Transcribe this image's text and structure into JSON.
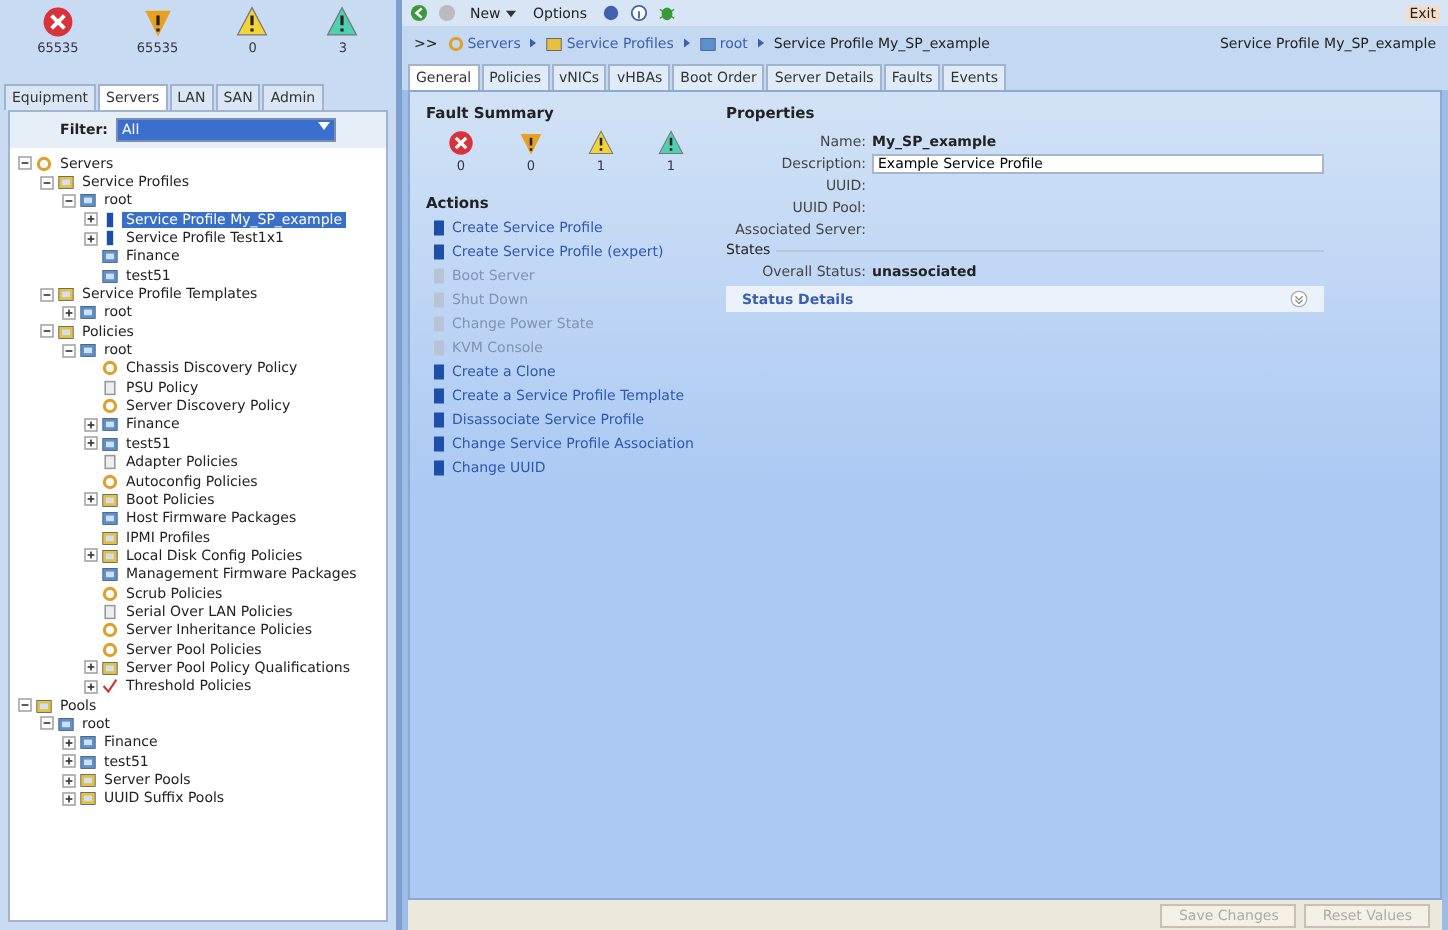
{
  "left_panel": {
    "faults": [
      {
        "kind": "critical",
        "count": "65535"
      },
      {
        "kind": "major",
        "count": "65535"
      },
      {
        "kind": "minor",
        "count": "0"
      },
      {
        "kind": "warning",
        "count": "3"
      }
    ],
    "tabs": [
      {
        "label": "Equipment",
        "selected": false
      },
      {
        "label": "Servers",
        "selected": true
      },
      {
        "label": "LAN",
        "selected": false
      },
      {
        "label": "SAN",
        "selected": false
      },
      {
        "label": "Admin",
        "selected": false
      }
    ],
    "filter": {
      "label": "Filter:",
      "value": "All"
    },
    "tree": [
      {
        "label": "Servers",
        "kind": "gear",
        "expanded": true,
        "selected": false,
        "children": [
          {
            "label": "Service Profiles",
            "kind": "folder",
            "expanded": true,
            "selected": false,
            "children": [
              {
                "label": "root",
                "kind": "org",
                "expanded": true,
                "selected": false,
                "children": [
                  {
                    "label": "Service Profile My_SP_example",
                    "kind": "profile",
                    "expanded": false,
                    "selected": true
                  },
                  {
                    "label": "Service Profile Test1x1",
                    "kind": "profile",
                    "expanded": false,
                    "selected": false
                  },
                  {
                    "label": "Finance",
                    "kind": "org",
                    "selected": false
                  },
                  {
                    "label": "test51",
                    "kind": "org",
                    "selected": false
                  }
                ]
              }
            ]
          },
          {
            "label": "Service Profile Templates",
            "kind": "folder",
            "expanded": true,
            "selected": false,
            "children": [
              {
                "label": "root",
                "kind": "org",
                "expanded": false,
                "selected": false
              }
            ]
          },
          {
            "label": "Policies",
            "kind": "folder",
            "expanded": true,
            "selected": false,
            "children": [
              {
                "label": "root",
                "kind": "org",
                "expanded": true,
                "selected": false,
                "children": [
                  {
                    "label": "Chassis Discovery Policy",
                    "kind": "gear",
                    "selected": false
                  },
                  {
                    "label": "PSU Policy",
                    "kind": "doc",
                    "selected": false
                  },
                  {
                    "label": "Server Discovery Policy",
                    "kind": "gear",
                    "selected": false
                  },
                  {
                    "label": "Finance",
                    "kind": "org",
                    "expanded": false,
                    "selected": false
                  },
                  {
                    "label": "test51",
                    "kind": "org",
                    "expanded": false,
                    "selected": false
                  },
                  {
                    "label": "Adapter Policies",
                    "kind": "doc",
                    "selected": false
                  },
                  {
                    "label": "Autoconfig Policies",
                    "kind": "gear",
                    "selected": false
                  },
                  {
                    "label": "Boot Policies",
                    "kind": "folder",
                    "expanded": false,
                    "selected": false
                  },
                  {
                    "label": "Host Firmware Packages",
                    "kind": "org",
                    "selected": false
                  },
                  {
                    "label": "IPMI Profiles",
                    "kind": "folder",
                    "selected": false
                  },
                  {
                    "label": "Local Disk Config Policies",
                    "kind": "folder",
                    "expanded": false,
                    "selected": false
                  },
                  {
                    "label": "Management Firmware Packages",
                    "kind": "org",
                    "selected": false
                  },
                  {
                    "label": "Scrub Policies",
                    "kind": "gear",
                    "selected": false
                  },
                  {
                    "label": "Serial Over LAN Policies",
                    "kind": "doc",
                    "selected": false
                  },
                  {
                    "label": "Server Inheritance Policies",
                    "kind": "gear",
                    "selected": false
                  },
                  {
                    "label": "Server Pool Policies",
                    "kind": "gear",
                    "selected": false
                  },
                  {
                    "label": "Server Pool Policy Qualifications",
                    "kind": "folder",
                    "expanded": false,
                    "selected": false
                  },
                  {
                    "label": "Threshold Policies",
                    "kind": "check",
                    "expanded": false,
                    "selected": false
                  }
                ]
              }
            ]
          }
        ]
      },
      {
        "label": "Pools",
        "kind": "folder",
        "expanded": true,
        "selected": false,
        "children": [
          {
            "label": "root",
            "kind": "org",
            "expanded": true,
            "selected": false,
            "children": [
              {
                "label": "Finance",
                "kind": "org",
                "expanded": false,
                "selected": false
              },
              {
                "label": "test51",
                "kind": "org",
                "expanded": false,
                "selected": false
              },
              {
                "label": "Server Pools",
                "kind": "folder",
                "expanded": false,
                "selected": false
              },
              {
                "label": "UUID Suffix Pools",
                "kind": "folder",
                "expanded": false,
                "selected": false
              }
            ]
          }
        ]
      }
    ]
  },
  "toolbar": {
    "new_label": "New",
    "options_label": "Options",
    "exit_label": "Exit"
  },
  "breadcrumb": {
    "prefix": ">>",
    "items": [
      {
        "label": "Servers",
        "kind": "gear"
      },
      {
        "label": "Service Profiles",
        "kind": "folder"
      },
      {
        "label": "root",
        "kind": "org"
      }
    ],
    "current": "Service Profile My_SP_example",
    "right_label": "Service Profile My_SP_example"
  },
  "tabs": [
    {
      "label": "General",
      "selected": true
    },
    {
      "label": "Policies",
      "selected": false
    },
    {
      "label": "vNICs",
      "selected": false
    },
    {
      "label": "vHBAs",
      "selected": false
    },
    {
      "label": "Boot Order",
      "selected": false
    },
    {
      "label": "Server Details",
      "selected": false
    },
    {
      "label": "Faults",
      "selected": false
    },
    {
      "label": "Events",
      "selected": false
    }
  ],
  "general": {
    "fault_summary_title": "Fault Summary",
    "faults": [
      {
        "kind": "critical",
        "count": "0"
      },
      {
        "kind": "major",
        "count": "0"
      },
      {
        "kind": "minor",
        "count": "1"
      },
      {
        "kind": "warning",
        "count": "1"
      }
    ],
    "actions_title": "Actions",
    "actions": [
      {
        "label": "Create Service Profile",
        "disabled": false
      },
      {
        "label": "Create Service Profile (expert)",
        "disabled": false
      },
      {
        "label": "Boot Server",
        "disabled": true
      },
      {
        "label": "Shut Down",
        "disabled": true
      },
      {
        "label": "Change Power State",
        "disabled": true
      },
      {
        "label": "KVM Console",
        "disabled": true
      },
      {
        "label": "Create a Clone",
        "disabled": false
      },
      {
        "label": "Create a Service Profile Template",
        "disabled": false
      },
      {
        "label": "Disassociate Service Profile",
        "disabled": false
      },
      {
        "label": "Change Service Profile Association",
        "disabled": false
      },
      {
        "label": "Change UUID",
        "disabled": false
      }
    ],
    "properties_title": "Properties",
    "properties": [
      {
        "label": "Name:",
        "kind": "bold",
        "value": "My_SP_example"
      },
      {
        "label": "Description:",
        "kind": "field",
        "value": "Example Service Profile"
      },
      {
        "label": "UUID:",
        "kind": "empty"
      },
      {
        "label": "UUID Pool:",
        "kind": "empty"
      },
      {
        "label": "Associated Server:",
        "kind": "empty"
      }
    ],
    "states_title": "States",
    "overall_status": {
      "label": "Overall Status:",
      "value": "unassociated"
    },
    "status_details": "Status Details"
  },
  "footer_buttons": [
    {
      "label": "Save Changes",
      "disabled": true
    },
    {
      "label": "Reset Values",
      "disabled": true
    }
  ]
}
